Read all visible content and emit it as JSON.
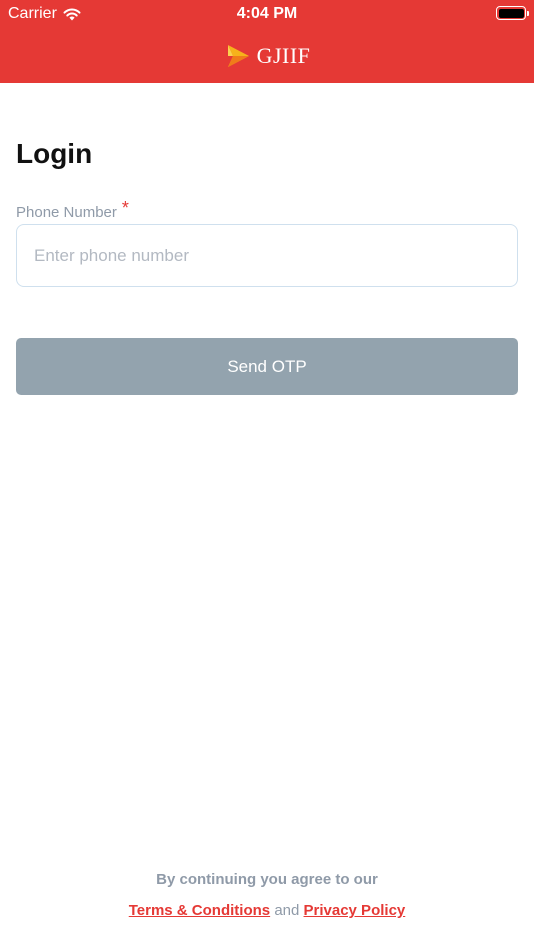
{
  "status_bar": {
    "carrier": "Carrier",
    "time": "4:04 PM"
  },
  "brand": {
    "name": "GJIIF"
  },
  "colors": {
    "header": "#e53935",
    "accent": "#e53935",
    "button": "#93a3ae"
  },
  "login": {
    "title": "Login",
    "phone_label": "Phone Number",
    "required_mark": "*",
    "phone_placeholder": "Enter phone number",
    "phone_value": "",
    "send_otp_label": "Send OTP"
  },
  "footer": {
    "agree_text": "By continuing you agree to our",
    "terms_label": "Terms & Conditions",
    "and_text": "and",
    "privacy_label": "Privacy Policy"
  }
}
